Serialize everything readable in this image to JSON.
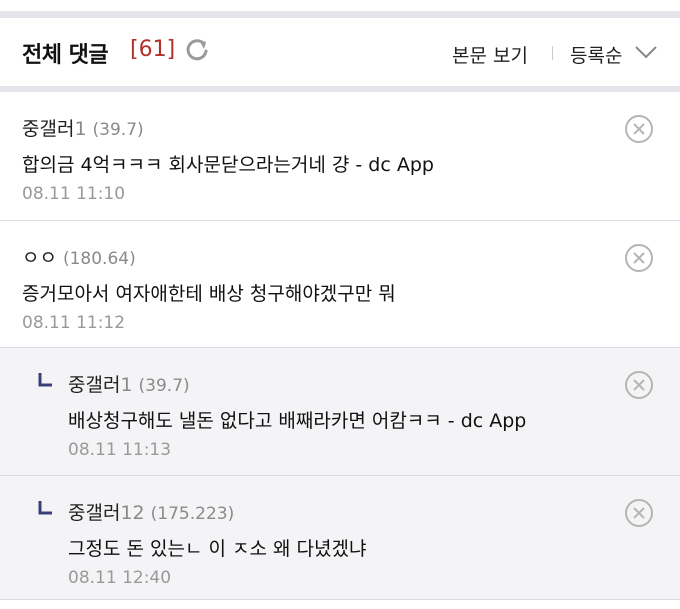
{
  "header": {
    "title": "전체 댓글",
    "count": "[61]",
    "view_body": "본문 보기",
    "sort": "등록순"
  },
  "comments": [
    {
      "nick": "중갤러",
      "level": "1",
      "ip": "(39.7)",
      "text": "합의금 4억ㅋㅋㅋ 회사문닫으라는거네 걍 - dc App",
      "date": "08.11 11:10",
      "reply": false
    },
    {
      "nick": "ㅇㅇ",
      "level": "",
      "ip": "(180.64)",
      "text": "증거모아서 여자애한테 배상 청구해야겠구만 뭐",
      "date": "08.11 11:12",
      "reply": false
    },
    {
      "nick": "중갤러",
      "level": "1",
      "ip": "(39.7)",
      "text": "배상청구해도 낼돈 없다고 배째라카면 어캄ㅋㅋ - dc App",
      "date": "08.11 11:13",
      "reply": true
    },
    {
      "nick": "중갤러",
      "level": "12",
      "ip": "(175.223)",
      "text": "그정도 돈 있는ㄴ 이 ㅈ소 왜 다녔겠냐",
      "date": "08.11 12:40",
      "reply": true
    }
  ],
  "colors": {
    "count": "#b3312c",
    "accent_gray": "#e4e4ea",
    "reply_bg": "#f4f4f6"
  },
  "icons": {
    "refresh": "refresh-icon",
    "chevron": "chevron-down-icon",
    "delete": "close-circle-icon",
    "reply": "reply-arrow-icon"
  }
}
